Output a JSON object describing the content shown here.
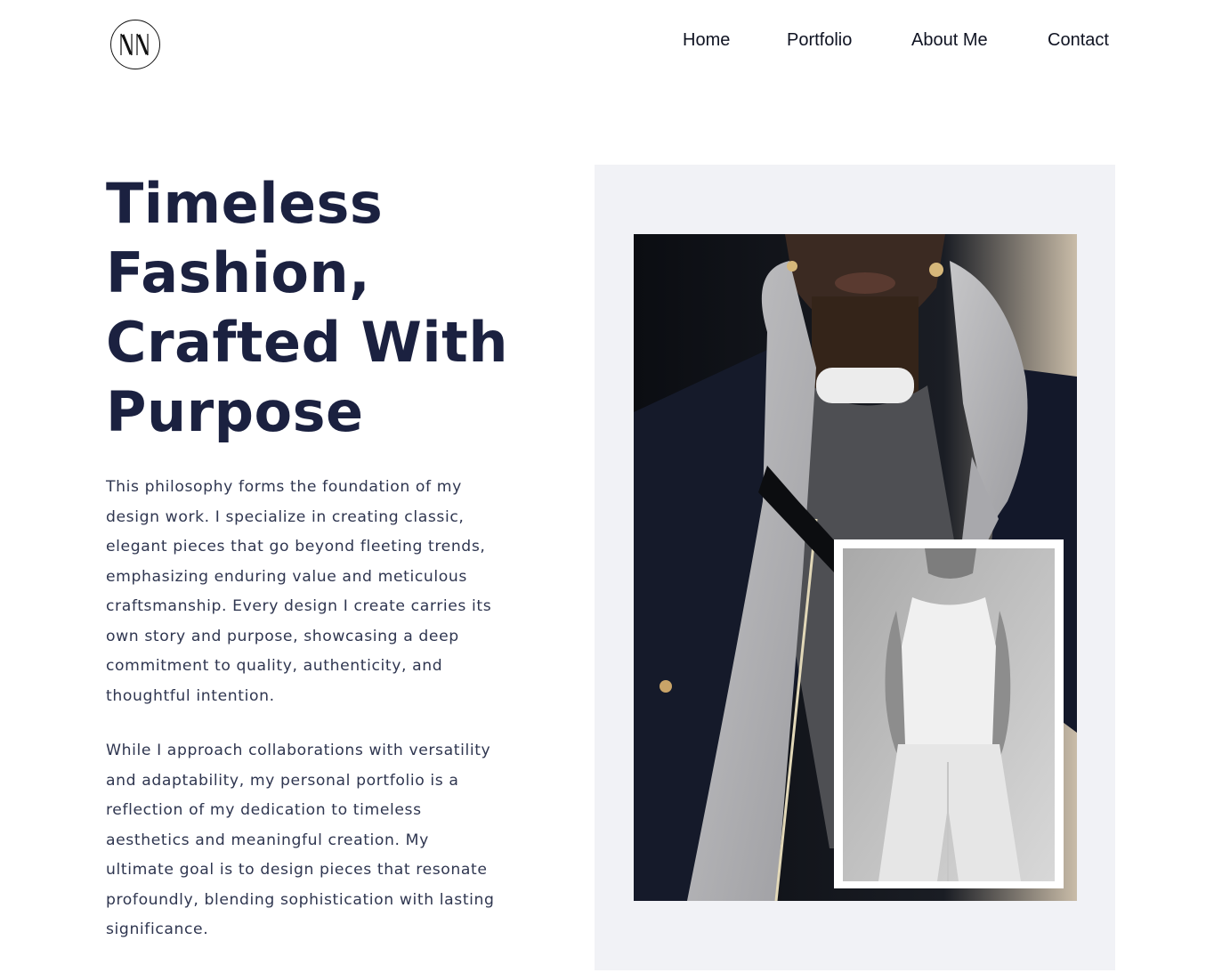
{
  "header": {
    "logo_text": "NN",
    "nav": [
      {
        "label": "Home"
      },
      {
        "label": "Portfolio"
      },
      {
        "label": "About Me"
      },
      {
        "label": "Contact"
      }
    ]
  },
  "hero": {
    "title_lines": [
      "Timeless",
      "Fashion,",
      "Crafted With",
      "Purpose"
    ],
    "paragraphs": [
      "This philosophy forms the foundation of my design work. I specialize in creating classic, elegant pieces that go beyond fleeting trends, emphasizing enduring value and meticulous craftsmanship. Every design I create carries its own story and purpose, showcasing a deep commitment to quality, authenticity, and thoughtful intention.",
      "While I approach collaborations with versatility and adaptability, my personal portfolio is a reflection of my dedication to timeless aesthetics and meaningful creation. My ultimate goal is to design pieces that resonate profoundly, blending sophistication with lasting significance."
    ]
  },
  "colors": {
    "heading": "#1b2140",
    "body_text": "#2f3650",
    "panel_bg": "#f1f2f6"
  }
}
